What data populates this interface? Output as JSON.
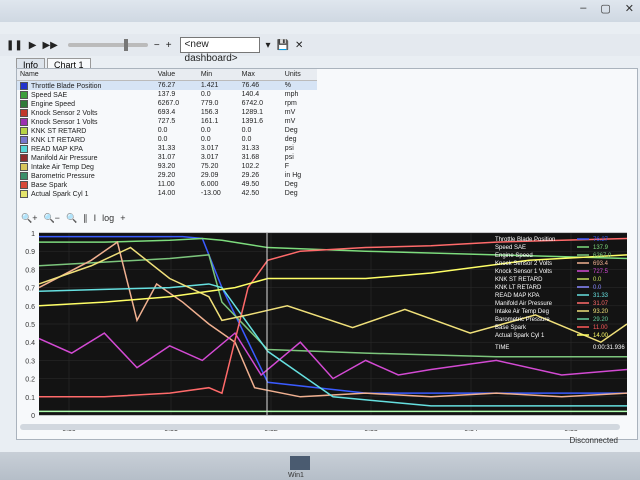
{
  "app": {
    "window_controls": [
      "–",
      "▢",
      "✕"
    ]
  },
  "toolbar": {
    "dashboard": "<new dashboard>"
  },
  "tabs": [
    "Info",
    "Chart 1"
  ],
  "table": {
    "headers": [
      "Name",
      "Value",
      "Min",
      "Max",
      "Units"
    ],
    "rows": [
      {
        "name": "Throttle Blade Position",
        "value": "76.27",
        "min": "1.421",
        "max": "76.46",
        "units": "%",
        "color": "#2233cc"
      },
      {
        "name": "Speed SAE",
        "value": "137.9",
        "min": "0.0",
        "max": "140.4",
        "units": "mph",
        "color": "#3c9f3c"
      },
      {
        "name": "Engine Speed",
        "value": "6267.0",
        "min": "779.0",
        "max": "6742.0",
        "units": "rpm",
        "color": "#2f7a3a"
      },
      {
        "name": "Knock Sensor 2 Volts",
        "value": "693.4",
        "min": "156.3",
        "max": "1289.1",
        "units": "mV",
        "color": "#c0392b"
      },
      {
        "name": "Knock Sensor 1 Volts",
        "value": "727.5",
        "min": "161.1",
        "max": "1391.6",
        "units": "mV",
        "color": "#9b30b0"
      },
      {
        "name": "KNK ST RETARD",
        "value": "0.0",
        "min": "0.0",
        "max": "0.0",
        "units": "Deg",
        "color": "#b7d445"
      },
      {
        "name": "KNK LT RETARD",
        "value": "0.0",
        "min": "0.0",
        "max": "0.0",
        "units": "deg",
        "color": "#7777cc"
      },
      {
        "name": "READ MAP KPA",
        "value": "31.33",
        "min": "3.017",
        "max": "31.33",
        "units": "psi",
        "color": "#55d6d6"
      },
      {
        "name": "Manifold Air Pressure",
        "value": "31.07",
        "min": "3.017",
        "max": "31.68",
        "units": "psi",
        "color": "#8f2d2d"
      },
      {
        "name": "Intake Air Temp Deg",
        "value": "93.20",
        "min": "75.20",
        "max": "102.2",
        "units": "F",
        "color": "#d8c65a"
      },
      {
        "name": "Barometric Pressure",
        "value": "29.20",
        "min": "29.09",
        "max": "29.26",
        "units": "in Hg",
        "color": "#3b8f6a"
      },
      {
        "name": "Base Spark",
        "value": "11.00",
        "min": "6.000",
        "max": "49.50",
        "units": "Deg",
        "color": "#d84a3a"
      },
      {
        "name": "Actual Spark Cyl 1",
        "value": "14.00",
        "min": "-13.00",
        "max": "42.50",
        "units": "Deg",
        "color": "#e3e36b"
      }
    ]
  },
  "chart_tools": [
    "🔍+",
    "🔍−",
    "🔍",
    "∥",
    "I",
    "log",
    "+"
  ],
  "chart_data": {
    "type": "line",
    "x_ticks": [
      "0:30",
      "0:31",
      "0:32",
      "0:33",
      "0:34",
      "0:35"
    ],
    "y_ticks": [
      "1",
      "0.9",
      "0.8",
      "0.7",
      "0.6",
      "0.5",
      "0.4",
      "0.3",
      "0.2",
      "0.1",
      "0"
    ],
    "legend": [
      {
        "name": "Throttle Blade Position",
        "value": "76.27",
        "color": "#3a5bff"
      },
      {
        "name": "Speed SAE",
        "value": "137.9",
        "color": "#7ddc7d"
      },
      {
        "name": "Engine Speed",
        "value": "6267.0",
        "color": "#7cc57c"
      },
      {
        "name": "Knock Sensor 2 Volts",
        "value": "693.4",
        "color": "#f0b090"
      },
      {
        "name": "Knock Sensor 1 Volts",
        "value": "727.5",
        "color": "#d34ad3"
      },
      {
        "name": "KNK ST RETARD",
        "value": "0.0",
        "color": "#c9e060"
      },
      {
        "name": "KNK LT RETARD",
        "value": "0.0",
        "color": "#8888ff"
      },
      {
        "name": "READ MAP KPA",
        "value": "31.33",
        "color": "#66e0e0"
      },
      {
        "name": "Manifold Air Pressure",
        "value": "31.07",
        "color": "#ff6a6a"
      },
      {
        "name": "Intake Air Temp Deg",
        "value": "93.20",
        "color": "#f0e07a"
      },
      {
        "name": "Barometric Pressure",
        "value": "29.20",
        "color": "#69d0a0"
      },
      {
        "name": "Base Spark",
        "value": "11.00",
        "color": "#ff5a5a"
      },
      {
        "name": "Actual Spark Cyl 1",
        "value": "14.00",
        "color": "#ffff66"
      }
    ],
    "time_label": "TIME",
    "time_value": "0:00:31.936",
    "series": [
      {
        "color": "#3a5bff",
        "x": [
          0,
          6,
          12,
          18,
          22,
          25,
          28,
          35,
          50,
          60,
          70,
          80,
          90
        ],
        "y": [
          0.98,
          0.98,
          0.98,
          0.98,
          0.98,
          0.97,
          0.7,
          0.18,
          0.12,
          0.12,
          0.12,
          0.12,
          0.12
        ]
      },
      {
        "color": "#7ddc7d",
        "x": [
          0,
          10,
          20,
          25,
          28,
          35,
          50,
          70,
          90
        ],
        "y": [
          0.95,
          0.95,
          0.96,
          0.97,
          0.96,
          0.92,
          0.9,
          0.88,
          0.86
        ]
      },
      {
        "color": "#7cc57c",
        "x": [
          0,
          10,
          20,
          26,
          28,
          35,
          50,
          70,
          90
        ],
        "y": [
          0.82,
          0.84,
          0.86,
          0.88,
          0.62,
          0.36,
          0.34,
          0.32,
          0.32
        ]
      },
      {
        "color": "#f0b090",
        "x": [
          0,
          8,
          12,
          15,
          18,
          22,
          26,
          30,
          33,
          40,
          50,
          60,
          70,
          80,
          90
        ],
        "y": [
          0.7,
          0.85,
          0.95,
          0.52,
          0.72,
          0.62,
          0.5,
          0.4,
          0.15,
          0.1,
          0.12,
          0.1,
          0.12,
          0.1,
          0.12
        ]
      },
      {
        "color": "#d34ad3",
        "x": [
          0,
          5,
          10,
          15,
          20,
          25,
          30,
          34,
          40,
          45,
          50,
          55,
          60,
          70,
          80,
          90
        ],
        "y": [
          0.42,
          0.34,
          0.45,
          0.26,
          0.38,
          0.3,
          0.45,
          0.22,
          0.4,
          0.2,
          0.3,
          0.22,
          0.25,
          0.3,
          0.22,
          0.25
        ]
      },
      {
        "color": "#66e0e0",
        "x": [
          0,
          10,
          20,
          26,
          28,
          35,
          45,
          60,
          90
        ],
        "y": [
          0.68,
          0.69,
          0.7,
          0.72,
          0.7,
          0.35,
          0.1,
          0.05,
          0.05
        ]
      },
      {
        "color": "#ff6a6a",
        "x": [
          0,
          10,
          20,
          26,
          28,
          32,
          35,
          40,
          50,
          60,
          70,
          80,
          90
        ],
        "y": [
          0.1,
          0.1,
          0.12,
          0.15,
          0.12,
          0.7,
          0.85,
          0.9,
          0.92,
          0.93,
          0.95,
          0.96,
          0.97
        ]
      },
      {
        "color": "#f0e07a",
        "x": [
          0,
          8,
          14,
          20,
          26,
          28,
          32,
          38,
          48,
          56,
          66,
          76,
          86,
          90
        ],
        "y": [
          0.72,
          0.82,
          0.92,
          0.75,
          0.65,
          0.52,
          0.55,
          0.6,
          0.48,
          0.58,
          0.45,
          0.55,
          0.4,
          0.5
        ]
      },
      {
        "color": "#ffff66",
        "x": [
          0,
          10,
          20,
          30,
          35,
          50,
          60,
          75,
          90
        ],
        "y": [
          0.6,
          0.62,
          0.65,
          0.7,
          0.75,
          0.75,
          0.78,
          0.85,
          0.88
        ]
      },
      {
        "color": "#b0ffb0",
        "x": [
          0,
          30,
          60,
          90
        ],
        "y": [
          0.02,
          0.02,
          0.02,
          0.02
        ]
      }
    ]
  },
  "status": {
    "disconnected": "Disconnected"
  },
  "taskbar": {
    "label": "Win1"
  }
}
